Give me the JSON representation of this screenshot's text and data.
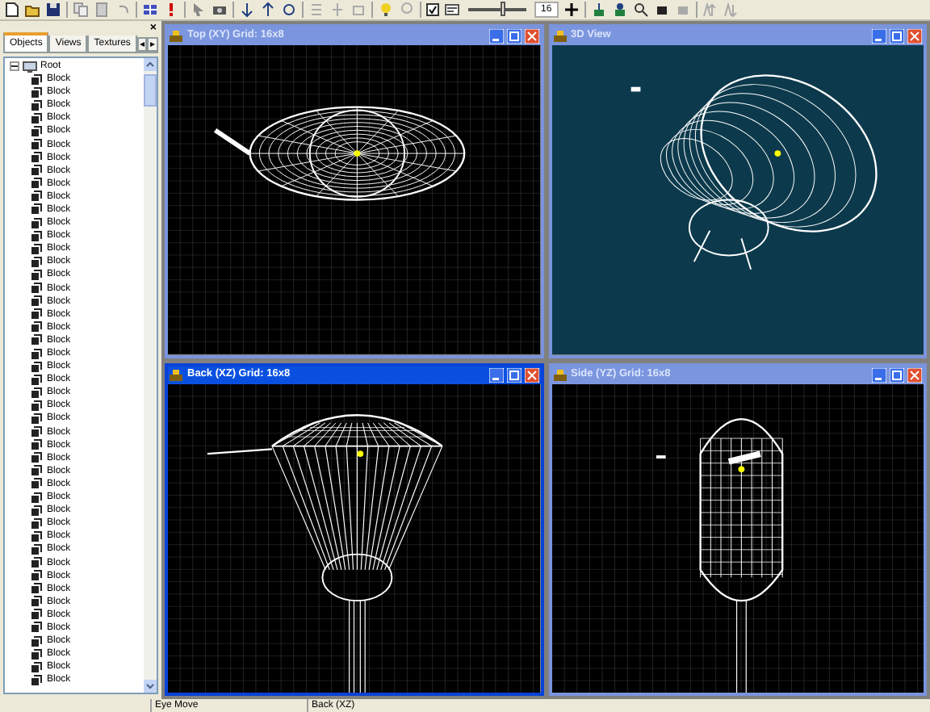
{
  "toolbar": {
    "snap_checked": true,
    "grid_size": "16",
    "slider": {
      "level": 0.55
    }
  },
  "panel": {
    "close": "×",
    "tabs": [
      {
        "label": "Objects",
        "selected": true
      },
      {
        "label": "Views",
        "selected": false
      },
      {
        "label": "Textures",
        "selected": false
      }
    ],
    "scroll_left": "◂",
    "scroll_right": "▸"
  },
  "tree": {
    "root": {
      "label": "Root",
      "expanded": true,
      "children": [
        {
          "label": "Block"
        },
        {
          "label": "Block"
        },
        {
          "label": "Block"
        },
        {
          "label": "Block"
        },
        {
          "label": "Block"
        },
        {
          "label": "Block"
        },
        {
          "label": "Block"
        },
        {
          "label": "Block"
        },
        {
          "label": "Block"
        },
        {
          "label": "Block"
        },
        {
          "label": "Block"
        },
        {
          "label": "Block"
        },
        {
          "label": "Block"
        },
        {
          "label": "Block"
        },
        {
          "label": "Block"
        },
        {
          "label": "Block"
        },
        {
          "label": "Block"
        },
        {
          "label": "Block"
        },
        {
          "label": "Block"
        },
        {
          "label": "Block"
        },
        {
          "label": "Block"
        },
        {
          "label": "Block"
        },
        {
          "label": "Block"
        },
        {
          "label": "Block"
        },
        {
          "label": "Block"
        },
        {
          "label": "Block"
        },
        {
          "label": "Block"
        },
        {
          "label": "Block"
        },
        {
          "label": "Block"
        },
        {
          "label": "Block"
        },
        {
          "label": "Block"
        },
        {
          "label": "Block"
        },
        {
          "label": "Block"
        },
        {
          "label": "Block"
        },
        {
          "label": "Block"
        },
        {
          "label": "Block"
        },
        {
          "label": "Block"
        },
        {
          "label": "Block"
        },
        {
          "label": "Block"
        },
        {
          "label": "Block"
        },
        {
          "label": "Block"
        },
        {
          "label": "Block"
        },
        {
          "label": "Block"
        },
        {
          "label": "Block"
        },
        {
          "label": "Block"
        },
        {
          "label": "Block"
        },
        {
          "label": "Block"
        }
      ]
    }
  },
  "viewports": [
    {
      "title": "Top (XY) Grid: 16x8",
      "kind": "top",
      "active": false
    },
    {
      "title": "3D View",
      "kind": "perspective",
      "active": false
    },
    {
      "title": "Back (XZ) Grid: 16x8",
      "kind": "back",
      "active": true
    },
    {
      "title": "Side (YZ) Grid: 16x8",
      "kind": "side",
      "active": false
    }
  ],
  "status_bar": [
    "Eye Move",
    "Back (XZ)"
  ]
}
